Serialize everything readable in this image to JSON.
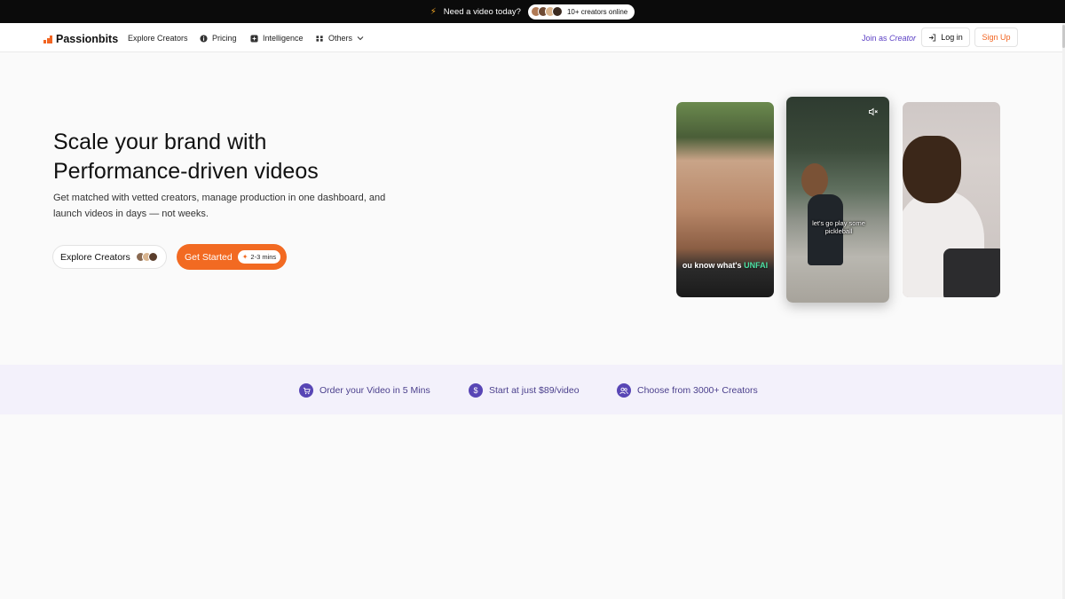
{
  "announcement": {
    "message": "Need a video today?",
    "online_count": "10+ creators online",
    "avatar_colors": [
      "#b07a55",
      "#6f4a33",
      "#d9b38c",
      "#3a2a20"
    ]
  },
  "nav": {
    "logo": "Passionbits",
    "brand_color": "#f26522",
    "items": [
      {
        "label": "Explore Creators",
        "icon": ""
      },
      {
        "label": "Pricing",
        "icon": "info-circle-icon"
      },
      {
        "label": "Intelligence",
        "icon": "sparkle-icon"
      },
      {
        "label": "Others",
        "icon": "grid-icon"
      }
    ],
    "join_prefix": "Join as",
    "join_word": "Creator",
    "login": "Log in",
    "signup": "Sign Up"
  },
  "hero": {
    "title_line1": "Scale your brand with",
    "title_line2": "Performance-driven videos",
    "subtitle": "Get matched with vetted creators, manage production in one dashboard, and launch videos in days — not weeks.",
    "explore_button": "Explore Creators",
    "start_button": "Get Started",
    "start_badge": "2-3 mins",
    "accent_color": "#f26a22"
  },
  "videos": [
    {
      "caption_prefix": "ou know what's ",
      "caption_highlight": "UNFAI"
    },
    {
      "caption": "let's go play some pickleball",
      "icon": "mute-icon"
    },
    {
      "caption": ""
    }
  ],
  "features": [
    {
      "label": "Order your Video in 5 Mins",
      "icon": "cart-icon"
    },
    {
      "label": "Start at just $89/video",
      "icon": "dollar-icon"
    },
    {
      "label": "Choose from 3000+ Creators",
      "icon": "users-icon"
    }
  ],
  "colors": {
    "feature_text": "#4a3f8c",
    "feature_icon_bg": "#5846b5",
    "strip_bg": "#f3f1fb"
  }
}
